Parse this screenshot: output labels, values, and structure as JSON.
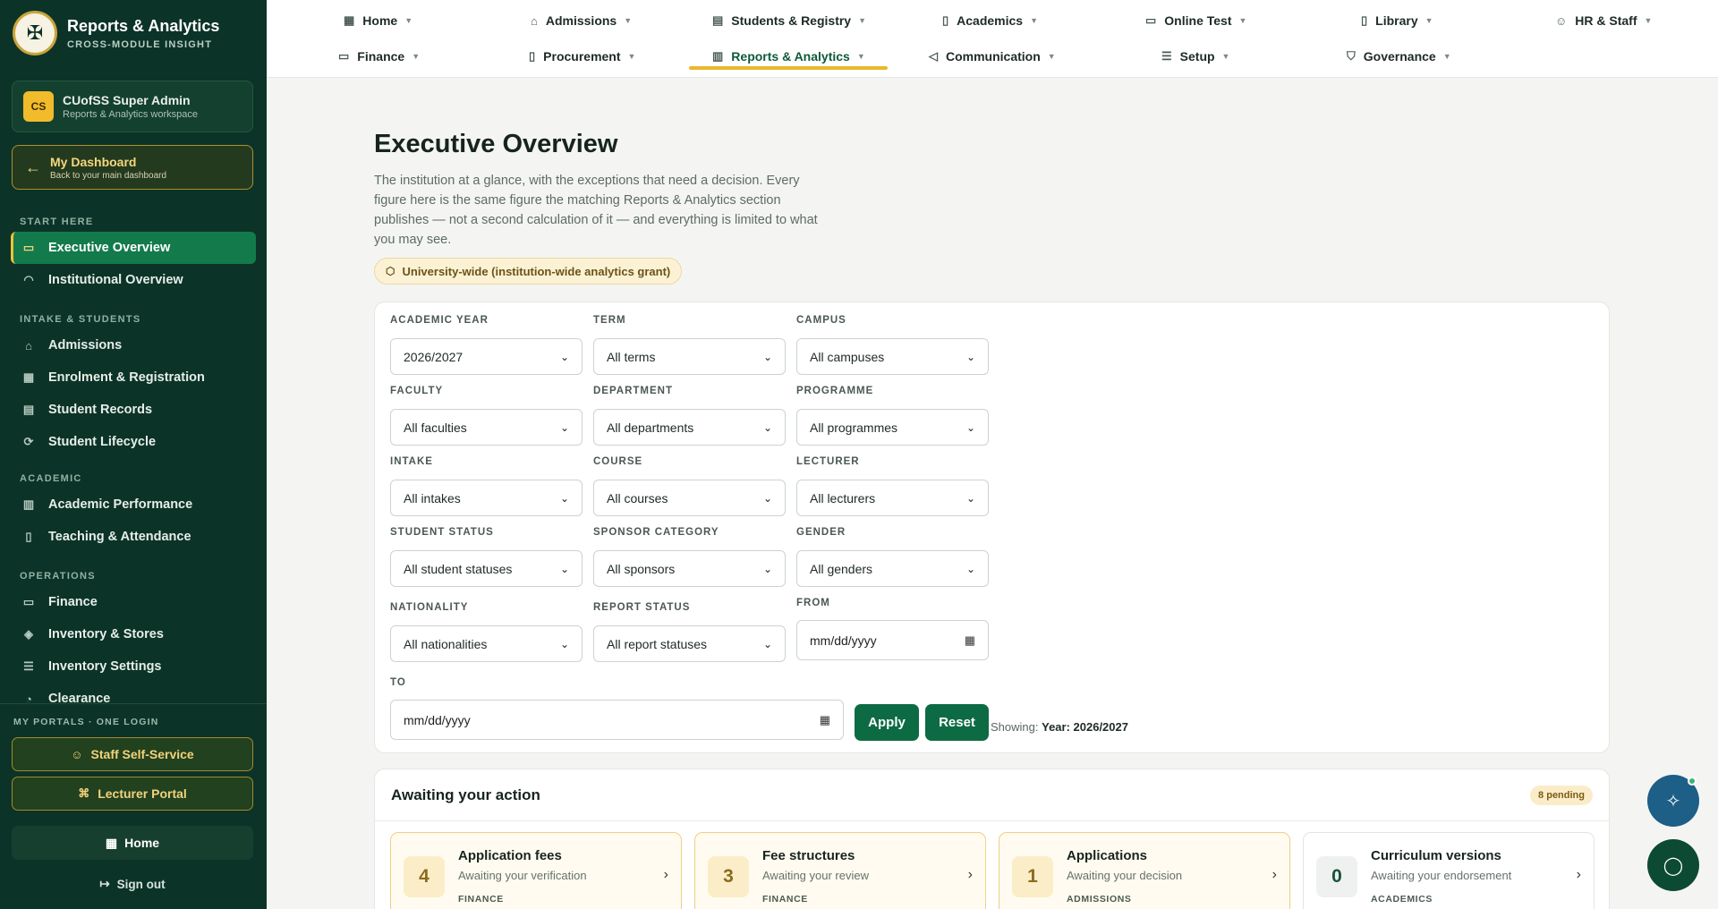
{
  "brand": {
    "title": "Reports & Analytics",
    "subtitle": "CROSS-MODULE INSIGHT"
  },
  "user": {
    "initials": "CS",
    "name": "CUofSS Super Admin",
    "role": "Reports & Analytics workspace"
  },
  "dashboard": {
    "title": "My Dashboard",
    "subtitle": "Back to your main dashboard"
  },
  "sidebar": {
    "sections": [
      {
        "label": "START HERE"
      },
      {
        "label": "INTAKE & STUDENTS"
      },
      {
        "label": "ACADEMIC"
      },
      {
        "label": "OPERATIONS"
      }
    ],
    "items": [
      {
        "label": "Executive Overview",
        "icon": "monitor-icon"
      },
      {
        "label": "Institutional Overview",
        "icon": "gauge-icon"
      },
      {
        "label": "Admissions",
        "icon": "inbox-icon"
      },
      {
        "label": "Enrolment & Registration",
        "icon": "calendar-icon"
      },
      {
        "label": "Student Records",
        "icon": "id-card-icon"
      },
      {
        "label": "Student Lifecycle",
        "icon": "route-icon"
      },
      {
        "label": "Academic Performance",
        "icon": "bar-chart-icon"
      },
      {
        "label": "Teaching & Attendance",
        "icon": "clipboard-icon"
      },
      {
        "label": "Finance",
        "icon": "credit-card-icon"
      },
      {
        "label": "Inventory & Stores",
        "icon": "layers-icon"
      },
      {
        "label": "Inventory Settings",
        "icon": "sliders-icon"
      },
      {
        "label": "Clearance",
        "icon": "check-circle-icon"
      }
    ]
  },
  "portals": {
    "label": "MY PORTALS · ONE LOGIN",
    "staff": "Staff Self-Service",
    "lecturer": "Lecturer Portal",
    "home": "Home",
    "signout": "Sign out"
  },
  "topnav": {
    "row1": [
      {
        "label": "Home"
      },
      {
        "label": "Admissions"
      },
      {
        "label": "Students & Registry"
      },
      {
        "label": "Academics"
      },
      {
        "label": "Online Test"
      },
      {
        "label": "Library"
      },
      {
        "label": "HR & Staff"
      }
    ],
    "row2": [
      {
        "label": "Finance"
      },
      {
        "label": "Procurement"
      },
      {
        "label": "Reports & Analytics"
      },
      {
        "label": "Communication"
      },
      {
        "label": "Setup"
      },
      {
        "label": "Governance"
      }
    ]
  },
  "page": {
    "title": "Executive Overview",
    "description": "The institution at a glance, with the exceptions that need a decision. Every figure here is the same figure the matching Reports & Analytics section publishes — not a second calculation of it — and everything is limited to what you may see.",
    "scope": "University-wide (institution-wide analytics grant)"
  },
  "filters": {
    "academic_year": {
      "label": "ACADEMIC YEAR",
      "value": "2026/2027"
    },
    "term": {
      "label": "TERM",
      "value": "All terms"
    },
    "campus": {
      "label": "CAMPUS",
      "value": "All campuses"
    },
    "faculty": {
      "label": "FACULTY",
      "value": "All faculties"
    },
    "department": {
      "label": "DEPARTMENT",
      "value": "All departments"
    },
    "programme": {
      "label": "PROGRAMME",
      "value": "All programmes"
    },
    "intake": {
      "label": "INTAKE",
      "value": "All intakes"
    },
    "course": {
      "label": "COURSE",
      "value": "All courses"
    },
    "lecturer": {
      "label": "LECTURER",
      "value": "All lecturers"
    },
    "student_status": {
      "label": "STUDENT STATUS",
      "value": "All student statuses"
    },
    "sponsor": {
      "label": "SPONSOR CATEGORY",
      "value": "All sponsors"
    },
    "gender": {
      "label": "GENDER",
      "value": "All genders"
    },
    "nationality": {
      "label": "NATIONALITY",
      "value": "All nationalities"
    },
    "report_status": {
      "label": "REPORT STATUS",
      "value": "All report statuses"
    },
    "from": {
      "label": "FROM",
      "value": "mm/dd/yyyy"
    },
    "to": {
      "label": "TO",
      "value": "mm/dd/yyyy"
    },
    "apply": "Apply",
    "reset": "Reset",
    "showing_label": "Showing:",
    "showing_value": "Year: 2026/2027"
  },
  "actions": {
    "title": "Awaiting your action",
    "pending": "8 pending",
    "tasks": [
      {
        "count": "4",
        "title": "Application fees",
        "sub": "Awaiting your verification",
        "tag": "FINANCE"
      },
      {
        "count": "3",
        "title": "Fee structures",
        "sub": "Awaiting your review",
        "tag": "FINANCE"
      },
      {
        "count": "1",
        "title": "Applications",
        "sub": "Awaiting your decision",
        "tag": "ADMISSIONS"
      },
      {
        "count": "0",
        "title": "Curriculum versions",
        "sub": "Awaiting your endorsement",
        "tag": "ACADEMICS"
      }
    ]
  },
  "colors": {
    "sidebar": "#0c3327",
    "accent": "#137a4c",
    "gold": "#e9b82c"
  }
}
